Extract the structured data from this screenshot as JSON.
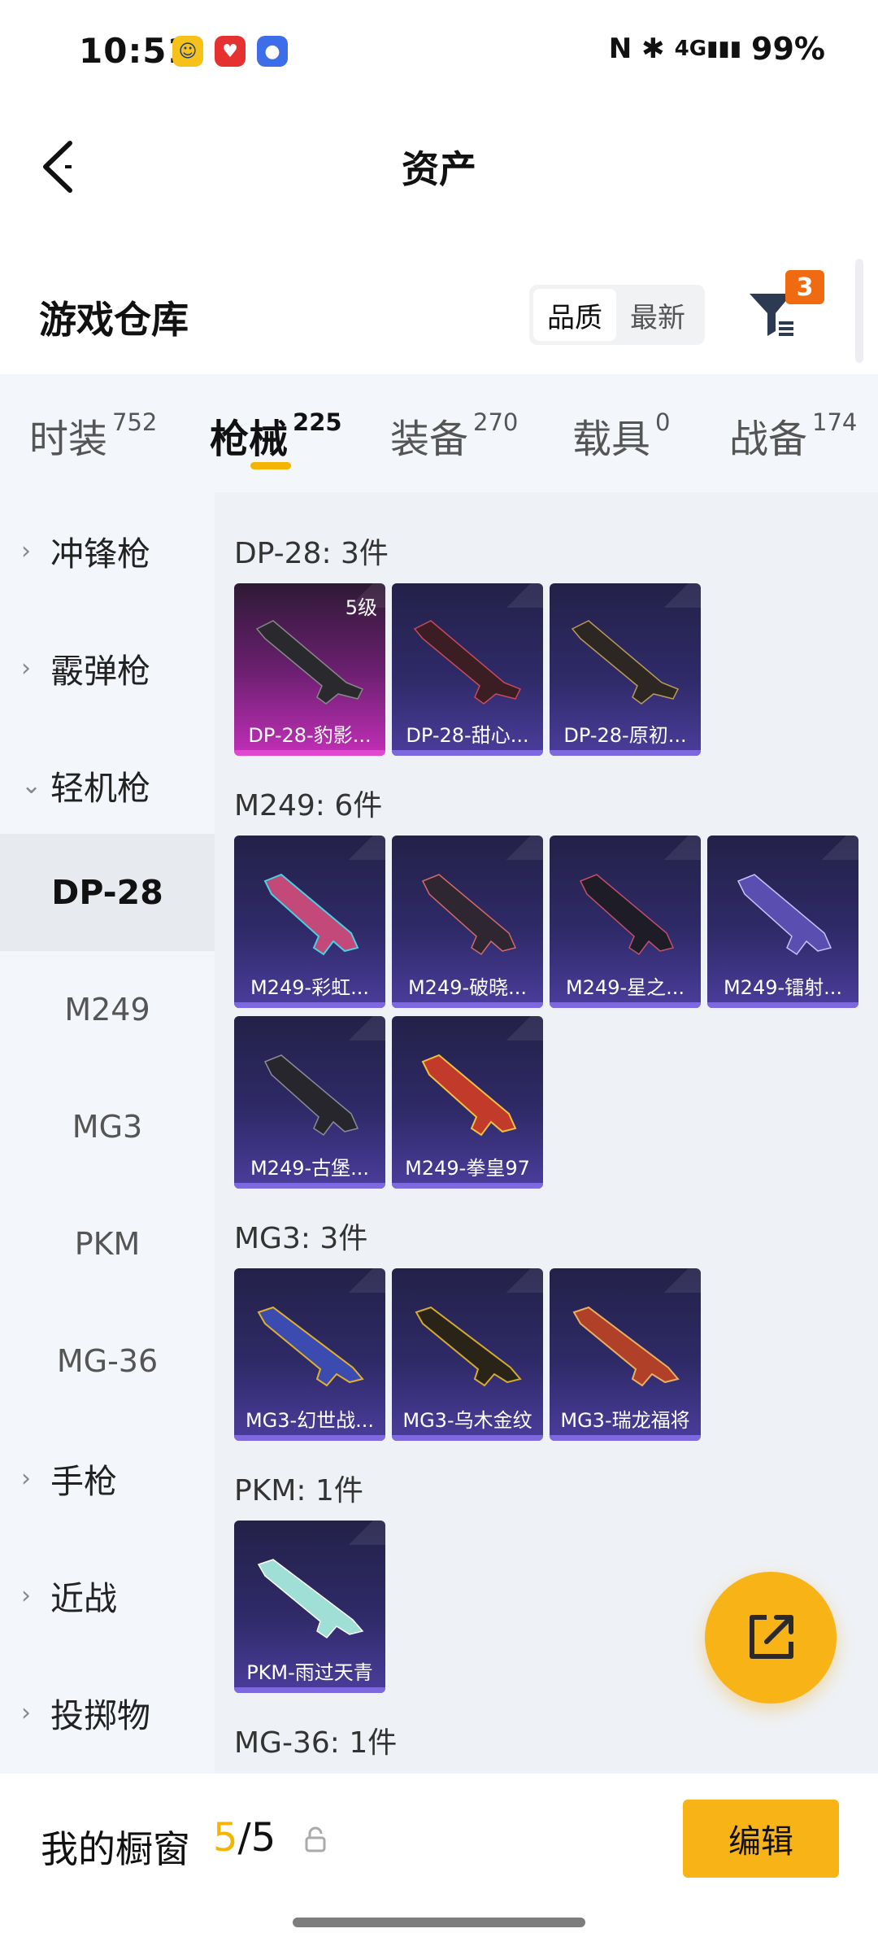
{
  "status_bar": {
    "time": "10:51",
    "apps": [
      "app-icon-yellow",
      "app-icon-red",
      "app-icon-blue"
    ],
    "network": "4G",
    "battery": "99%"
  },
  "header": {
    "title": "资产"
  },
  "warehouse": {
    "title": "游戏仓库",
    "sort_options": [
      {
        "label": "品质",
        "active": true
      },
      {
        "label": "最新",
        "active": false
      }
    ],
    "filter_badge": "3"
  },
  "tabs": [
    {
      "label": "时装",
      "count": "752",
      "active": false
    },
    {
      "label": "枪械",
      "count": "225",
      "active": true
    },
    {
      "label": "装备",
      "count": "270",
      "active": false
    },
    {
      "label": "载具",
      "count": "0",
      "active": false
    },
    {
      "label": "战备",
      "count": "174",
      "active": false
    }
  ],
  "left_nav": {
    "categories": [
      {
        "label": "冲锋枪",
        "expanded": false
      },
      {
        "label": "霰弹枪",
        "expanded": false
      },
      {
        "label": "轻机枪",
        "expanded": true
      },
      {
        "label": "手枪",
        "expanded": false
      },
      {
        "label": "近战",
        "expanded": false
      },
      {
        "label": "投掷物",
        "expanded": false
      }
    ],
    "subitems": [
      {
        "label": "DP-28",
        "active": true
      },
      {
        "label": "M249",
        "active": false
      },
      {
        "label": "MG3",
        "active": false
      },
      {
        "label": "PKM",
        "active": false
      },
      {
        "label": "MG-36",
        "active": false
      }
    ]
  },
  "sections": [
    {
      "title": "DP-28: 3件",
      "items": [
        {
          "label": "DP-28-豹影...",
          "level": "5级",
          "rarity": "pink"
        },
        {
          "label": "DP-28-甜心...",
          "rarity": "purple"
        },
        {
          "label": "DP-28-原初...",
          "rarity": "purple"
        }
      ]
    },
    {
      "title": "M249: 6件",
      "items": [
        {
          "label": "M249-彩虹...",
          "rarity": "purple"
        },
        {
          "label": "M249-破晓...",
          "rarity": "purple"
        },
        {
          "label": "M249-星之...",
          "rarity": "purple"
        },
        {
          "label": "M249-镭射...",
          "rarity": "purple"
        },
        {
          "label": "M249-古堡...",
          "rarity": "purple"
        },
        {
          "label": "M249-拳皇97",
          "rarity": "purple"
        }
      ]
    },
    {
      "title": "MG3: 3件",
      "items": [
        {
          "label": "MG3-幻世战...",
          "rarity": "purple"
        },
        {
          "label": "MG3-乌木金纹",
          "rarity": "purple"
        },
        {
          "label": "MG3-瑞龙福将",
          "rarity": "purple"
        }
      ]
    },
    {
      "title": "PKM: 1件",
      "items": [
        {
          "label": "PKM-雨过天青",
          "rarity": "purple"
        }
      ]
    },
    {
      "title": "MG-36: 1件",
      "items": []
    }
  ],
  "showcase": {
    "label": "我的橱窗",
    "current": "5",
    "total": "/5",
    "edit_label": "编辑"
  },
  "colors": {
    "accent": "#f8b416",
    "badge": "#f06a12",
    "rarity_pink": "#e048d2",
    "rarity_purple": "#7e68e0"
  }
}
